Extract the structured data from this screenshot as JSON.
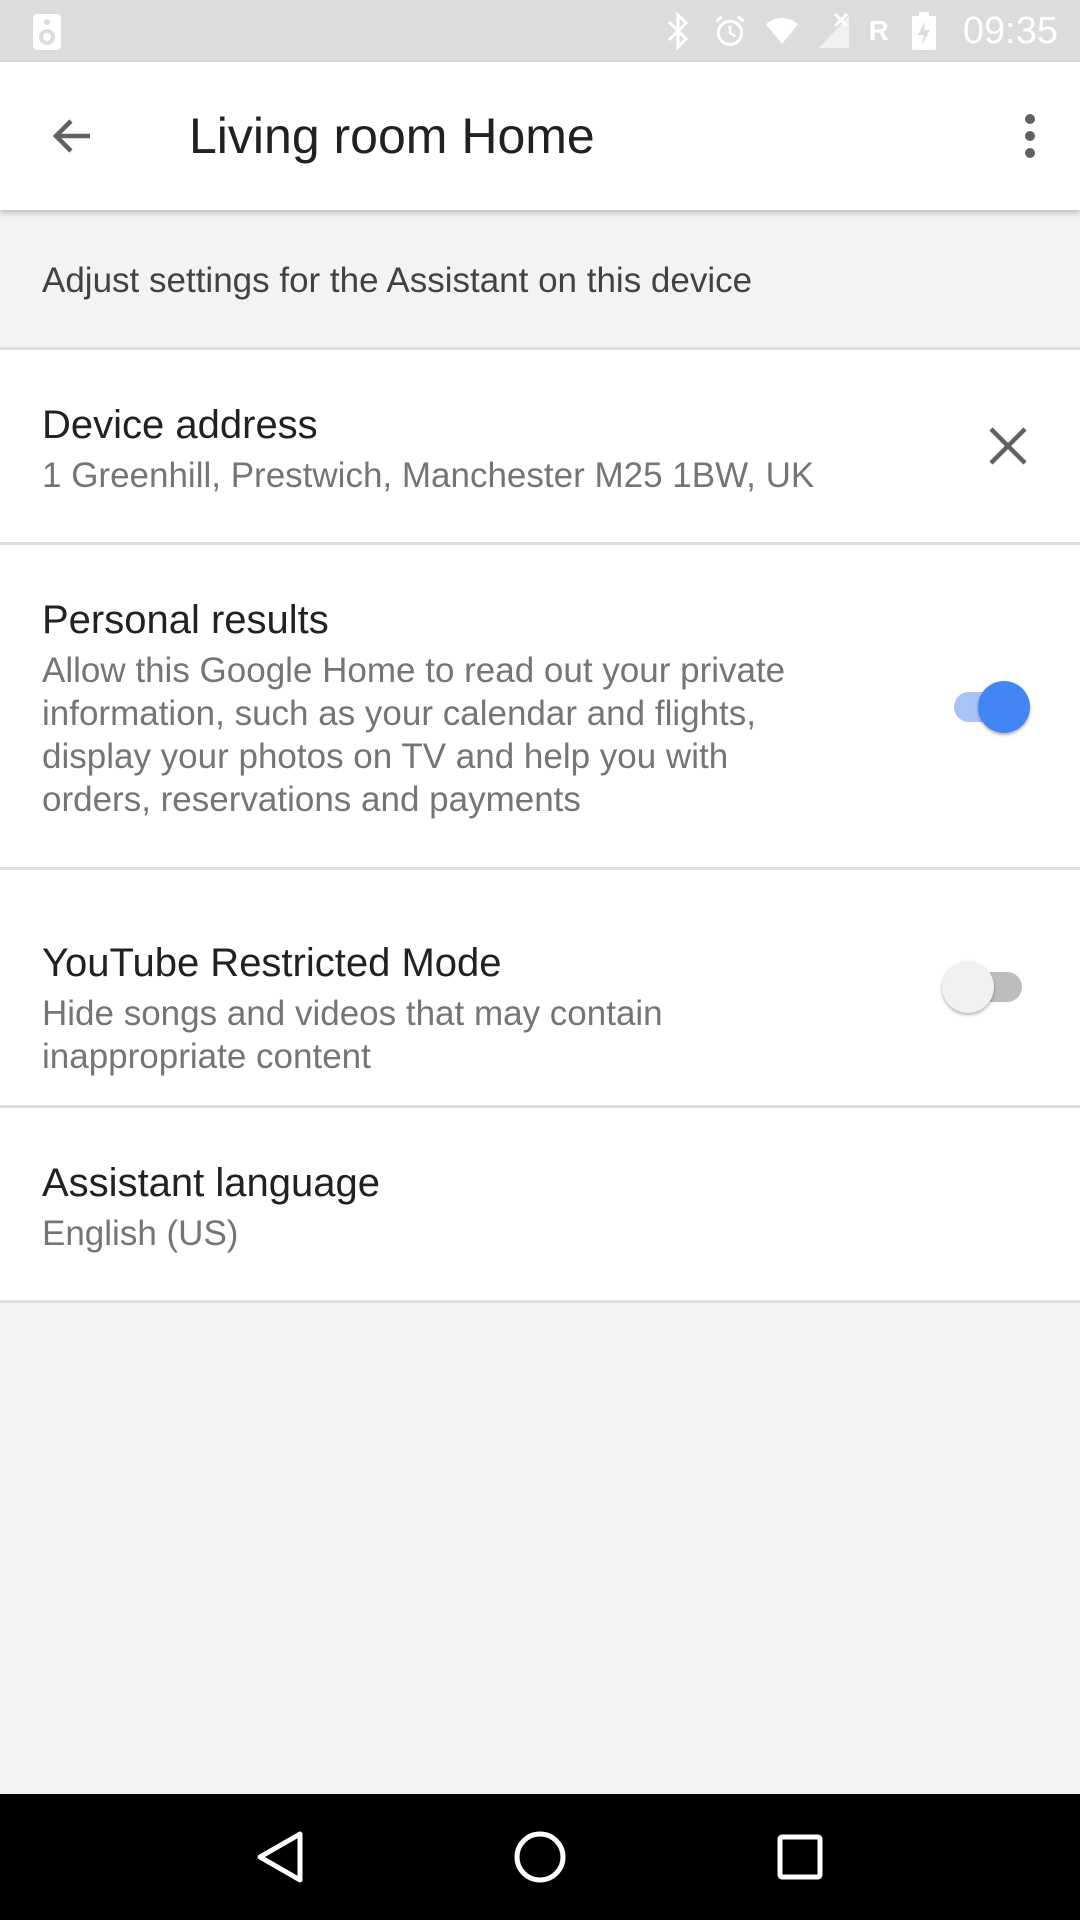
{
  "status_bar": {
    "time": "09:35",
    "r_indicator": "R",
    "icons": [
      "notification-speaker-icon",
      "bluetooth-icon",
      "alarm-icon",
      "wifi-icon",
      "signal-icon",
      "battery-icon"
    ]
  },
  "app_bar": {
    "title": "Living room Home",
    "back_icon": "arrow-back-icon",
    "menu_icon": "more-vert-icon"
  },
  "intro": {
    "text": "Adjust settings for the Assistant on this device"
  },
  "settings": {
    "device_address": {
      "title": "Device address",
      "value": "1 Greenhill, Prestwich, Manchester M25 1BW, UK",
      "action_icon": "close-icon"
    },
    "personal_results": {
      "title": "Personal results",
      "description": "Allow this Google Home to read out your private information, such as your calendar and flights, display your photos on TV and help you with orders, reservations and payments",
      "enabled": true
    },
    "youtube_restricted": {
      "title": "YouTube Restricted Mode",
      "description": "Hide songs and videos that may contain inappropriate content",
      "enabled": false
    },
    "assistant_language": {
      "title": "Assistant language",
      "value": "English (US)"
    }
  },
  "nav_bar": {
    "icons": [
      "nav-back-icon",
      "nav-home-icon",
      "nav-recents-icon"
    ]
  },
  "colors": {
    "accent": "#4285f4",
    "accent_track": "#a9c3f7",
    "status_bar": "#dcdcdc",
    "background": "#f3f3f3"
  }
}
